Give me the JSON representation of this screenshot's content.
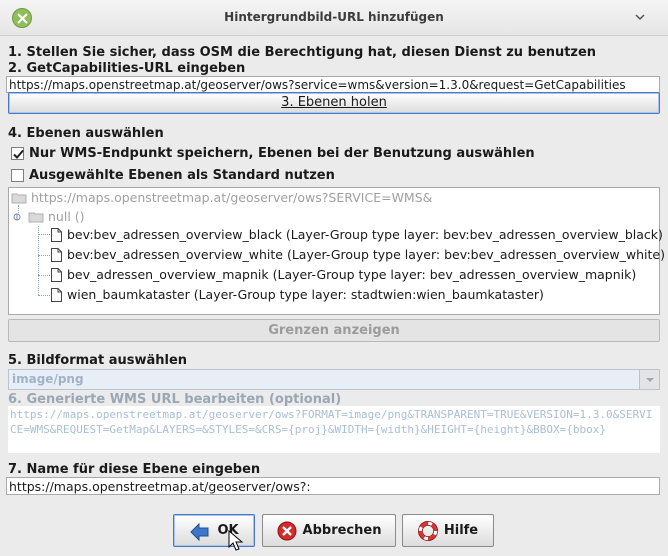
{
  "window": {
    "title": "Hintergrundbild-URL hinzufügen"
  },
  "steps": {
    "step1": "1. Stellen Sie sicher, dass OSM die Berechtigung hat, diesen Dienst zu benutzen",
    "step2": "2. GetCapabilities-URL eingeben",
    "step4": "4. Ebenen auswählen",
    "step5": "5. Bildformat auswählen",
    "step6": "6. Generierte WMS URL bearbeiten (optional)",
    "step7": "7. Name für diese Ebene eingeben"
  },
  "capabilities_url": "https://maps.openstreetmap.at/geoserver/ows?service=wms&version=1.3.0&request=GetCapabilities",
  "fetch_layers_button": "3. Ebenen holen",
  "options": {
    "wms_endpoint_only": {
      "label": "Nur WMS-Endpunkt speichern, Ebenen bei der Benutzung auswählen",
      "checked": true
    },
    "selected_default": {
      "label": "Ausgewählte Ebenen als Standard nutzen",
      "checked": false
    }
  },
  "tree": {
    "root": "https://maps.openstreetmap.at/geoserver/ows?SERVICE=WMS&",
    "group": "null ()",
    "layers": [
      "bev:bev_adressen_overview_black (Layer-Group type layer: bev:bev_adressen_overview_black)",
      "bev:bev_adressen_overview_white (Layer-Group type layer: bev:bev_adressen_overview_white)",
      "bev_adressen_overview_mapnik (Layer-Group type layer: bev_adressen_overview_mapnik)",
      "wien_baumkataster (Layer-Group type layer: stadtwien:wien_baumkataster)"
    ]
  },
  "show_bounds_button": "Grenzen anzeigen",
  "image_format": "image/png",
  "generated_url": "https://maps.openstreetmap.at/geoserver/ows?FORMAT=image/png&TRANSPARENT=TRUE&VERSION=1.3.0&SERVICE=WMS&REQUEST=GetMap&LAYERS=&STYLES=&CRS={proj}&WIDTH={width}&HEIGHT={height}&BBOX={bbox}",
  "layer_name": "https://maps.openstreetmap.at/geoserver/ows?:",
  "buttons": {
    "ok": "OK",
    "cancel": "Abbrechen",
    "help": "Hilfe"
  },
  "icons": {
    "close": "close-icon",
    "menu": "chevron-down-icon",
    "ok": "arrow-back-icon",
    "cancel": "cancel-icon",
    "help": "lifebuoy-icon"
  }
}
